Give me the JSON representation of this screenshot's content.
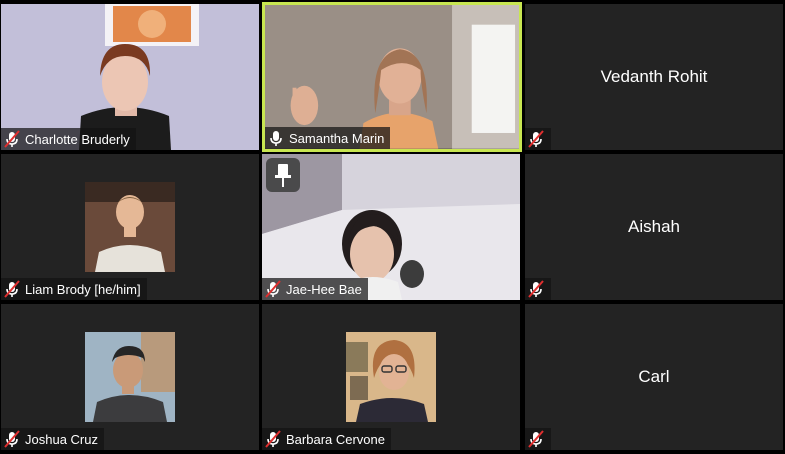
{
  "colors": {
    "tile_bg": "#232323",
    "active_border": "#c8e651",
    "muted_icon": "#e02f2f"
  },
  "tiles": [
    {
      "name": "Charlotte Bruderly",
      "mic": "muted",
      "video": true
    },
    {
      "name": "Samantha Marin",
      "mic": "on",
      "video": true,
      "active_speaker": true
    },
    {
      "name": "Vedanth Rohit",
      "mic": "muted",
      "video": false
    },
    {
      "name": "Liam Brody [he/him]",
      "mic": "muted",
      "video": true
    },
    {
      "name": "Jae-Hee Bae",
      "mic": "muted",
      "video": true,
      "pinned": true
    },
    {
      "name": "Aishah",
      "mic": "muted",
      "video": false
    },
    {
      "name": "Joshua Cruz",
      "mic": "muted",
      "video": true
    },
    {
      "name": "Barbara Cervone",
      "mic": "muted",
      "video": true
    },
    {
      "name": "Carl",
      "mic": "muted",
      "video": false
    }
  ],
  "icons": {
    "muted": "mic-muted-icon",
    "on": "mic-icon",
    "pin": "pin-icon"
  }
}
